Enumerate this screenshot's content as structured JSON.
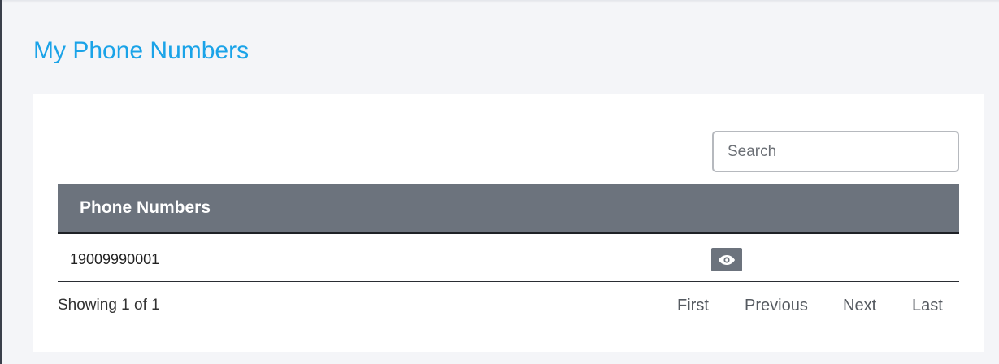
{
  "page": {
    "title": "My Phone Numbers"
  },
  "search": {
    "placeholder": "Search",
    "value": ""
  },
  "table": {
    "columns": [
      "Phone Numbers"
    ],
    "rows": [
      {
        "number": "19009990001",
        "action_icon": "eye-icon"
      }
    ]
  },
  "pagination": {
    "status": "Showing 1 of 1",
    "first": "First",
    "previous": "Previous",
    "next": "Next",
    "last": "Last"
  },
  "colors": {
    "title": "#1aa3e8",
    "header_bg": "#6c737d",
    "page_bg": "#f4f5f8"
  }
}
